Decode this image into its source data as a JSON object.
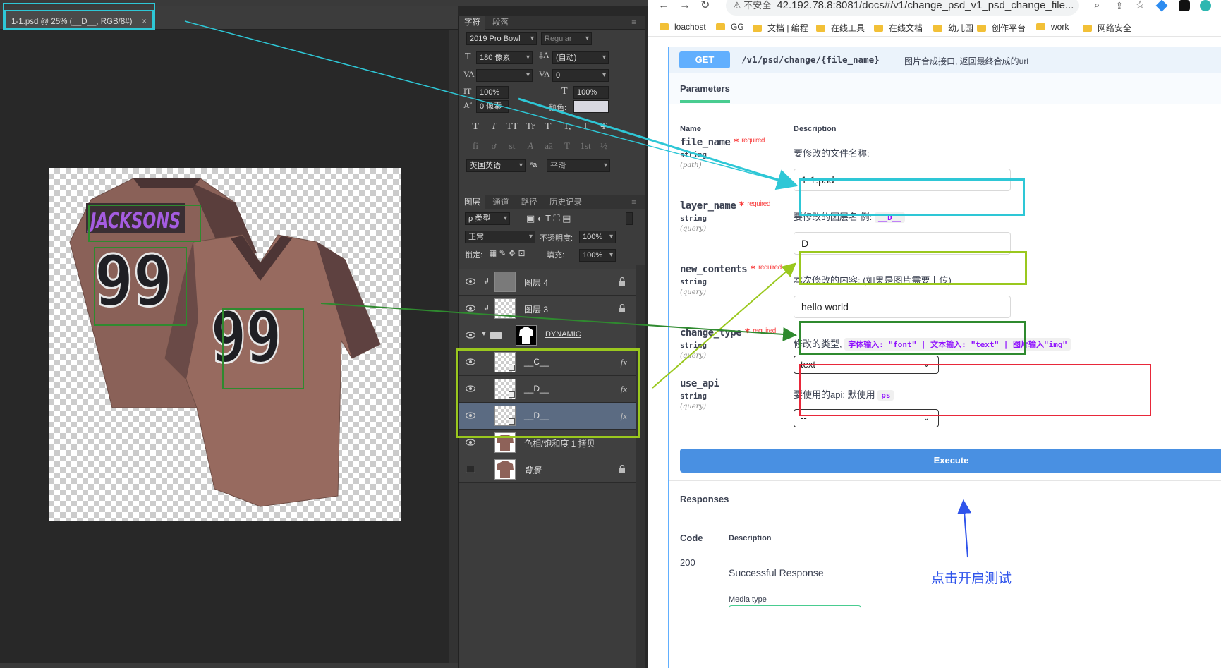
{
  "photoshop": {
    "document_tab": "1-1.psd @ 25% (__D__, RGB/8#)",
    "close_glyph": "×",
    "canvas_art": {
      "name_text": "JACKSONS",
      "back_number": "99",
      "front_number": "99"
    },
    "character_panel": {
      "tabs": [
        "字符",
        "段落"
      ],
      "menu_glyph": "≡",
      "font_family": "2019 Pro Bowl",
      "font_style": "Regular",
      "font_size": "180 像素",
      "leading": "(自动)",
      "tracking": "0",
      "vertical_scale": "100%",
      "horizontal_scale": "100%",
      "baseline_shift": "0 像素",
      "color_label": "颜色:",
      "glyph_buttons": [
        "T",
        "T",
        "TT",
        "Tr",
        "T'",
        "T,",
        "T",
        "T"
      ],
      "opentype_buttons": [
        "fi",
        "ơ",
        "st",
        "A",
        "aā",
        "T",
        "1st",
        "½"
      ],
      "language": "英国英语",
      "aa_label": "ªa",
      "antialias": "平滑"
    },
    "layers_panel": {
      "tabs": [
        "图层",
        "通道",
        "路径",
        "历史记录"
      ],
      "menu_glyph": "≡",
      "filter_type": "ρ 类型",
      "blend_mode": "正常",
      "opacity_label": "不透明度:",
      "opacity": "100%",
      "lock_label": "锁定:",
      "fill_label": "填充:",
      "fill": "100%",
      "fx_label": "fx",
      "lock_glyph": "🔒",
      "layers": [
        {
          "name": "图层 4",
          "visible": true,
          "locked": true,
          "kind": "gray"
        },
        {
          "name": "图层 3",
          "visible": true,
          "locked": true,
          "kind": "transparent"
        },
        {
          "name": "DYNAMIC",
          "visible": true,
          "kind": "group"
        },
        {
          "name": "__C__",
          "visible": true,
          "fx": true,
          "kind": "smart"
        },
        {
          "name": "__D__",
          "visible": true,
          "fx": true,
          "kind": "smart"
        },
        {
          "name": "__D__",
          "visible": true,
          "fx": true,
          "kind": "smart",
          "selected": true
        },
        {
          "name": "色相/饱和度 1 拷贝",
          "visible": true,
          "kind": "shirt"
        },
        {
          "name": "背景",
          "visible": false,
          "locked": true,
          "kind": "shirt"
        }
      ]
    }
  },
  "browser": {
    "nav": {
      "back": "←",
      "forward": "→",
      "reload": "↻"
    },
    "insecure_label": "⚠ 不安全",
    "url": "42.192.78.8:8081/docs#/v1/change_psd_v1_psd_change_file...",
    "toolbar_icons": [
      "⌕",
      "⇪",
      "☆"
    ],
    "bookmarks": [
      "loachost",
      "GG",
      "文档 | 编程",
      "在线工具",
      "在线文档",
      "幼儿园",
      "创作平台",
      "work",
      "网络安全"
    ]
  },
  "swagger": {
    "method": "GET",
    "path": "/v1/psd/change/{file_name}",
    "summary": "图片合成接口, 返回最终合成的url",
    "parameters_tab": "Parameters",
    "col_name": "Name",
    "col_description": "Description",
    "required_label": "required",
    "required_star": "*",
    "params": [
      {
        "name": "file_name",
        "type": "string",
        "in": "(path)",
        "description": "要修改的文件名称:",
        "value": "1-1.psd"
      },
      {
        "name": "layer_name",
        "type": "string",
        "in": "(query)",
        "description": "要修改的图层名 例:",
        "example": "__D__",
        "value": "D"
      },
      {
        "name": "new_contents",
        "type": "string",
        "in": "(query)",
        "description": "本次修改的内容: (如果是图片需要上传)",
        "value": "hello world"
      },
      {
        "name": "change_type",
        "type": "string",
        "in": "(query)",
        "description": "修改的类型,",
        "hint": "字体输入: \"font\" | 文本输入: \"text\" | 图片输入\"img\"",
        "selected": "text"
      },
      {
        "name": "use_api",
        "type": "string",
        "in": "(query)",
        "description": "要使用的api: 默使用",
        "example": "ps",
        "selected": "--"
      }
    ],
    "execute_label": "Execute",
    "responses_title": "Responses",
    "code_header": "Code",
    "desc_header": "Description",
    "response_code": "200",
    "response_desc": "Successful Response",
    "media_type_label": "Media type"
  },
  "annotation": {
    "test_note": "点击开启测试",
    "colors": {
      "cyan": "#2ec7d6",
      "lime": "#9ac81e",
      "green": "#2f8a2f",
      "red": "#e8283a",
      "blue": "#2f54eb"
    }
  }
}
